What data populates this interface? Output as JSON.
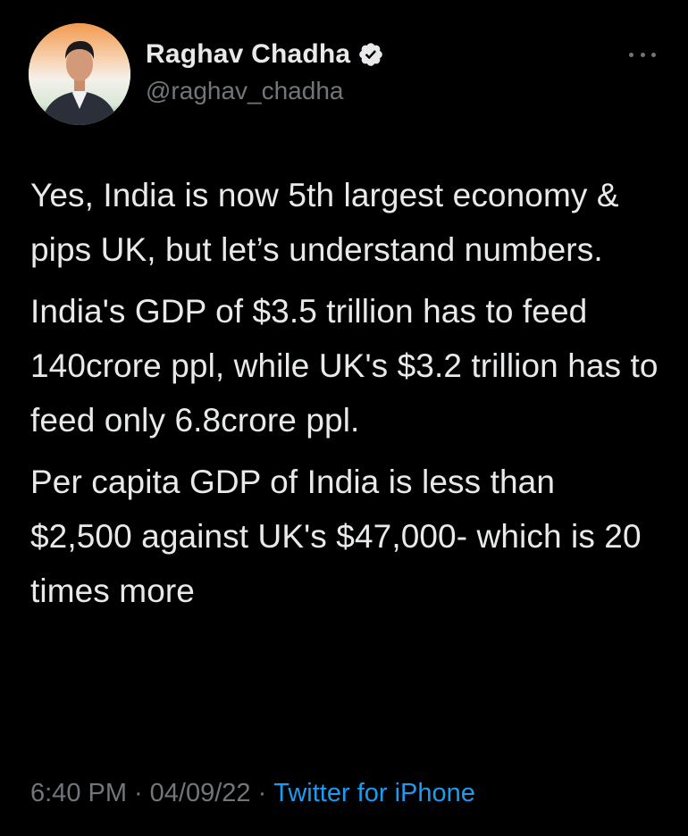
{
  "author": {
    "display_name": "Raghav Chadha",
    "handle": "@raghav_chadha",
    "verified": true,
    "avatar_icon": "profile-photo"
  },
  "tweet": {
    "paragraphs": [
      "Yes, India is now 5th largest economy & pips UK, but let’s understand numbers.",
      "India's GDP of $3.5 trillion has to feed 140crore ppl, while UK's $3.2 trillion has to feed only 6.8crore ppl.",
      "Per capita GDP of India is less than $2,500 against UK's $47,000- which is 20 times more"
    ]
  },
  "meta": {
    "time": "6:40 PM",
    "separator": "·",
    "date": "04/09/22",
    "source": "Twitter for iPhone"
  },
  "icons": {
    "more": "more-horizontal-icon",
    "verified": "verified-badge-icon"
  },
  "colors": {
    "background": "#000000",
    "text": "#e7e9ea",
    "secondary": "#71767b",
    "link": "#1d9bf0"
  }
}
